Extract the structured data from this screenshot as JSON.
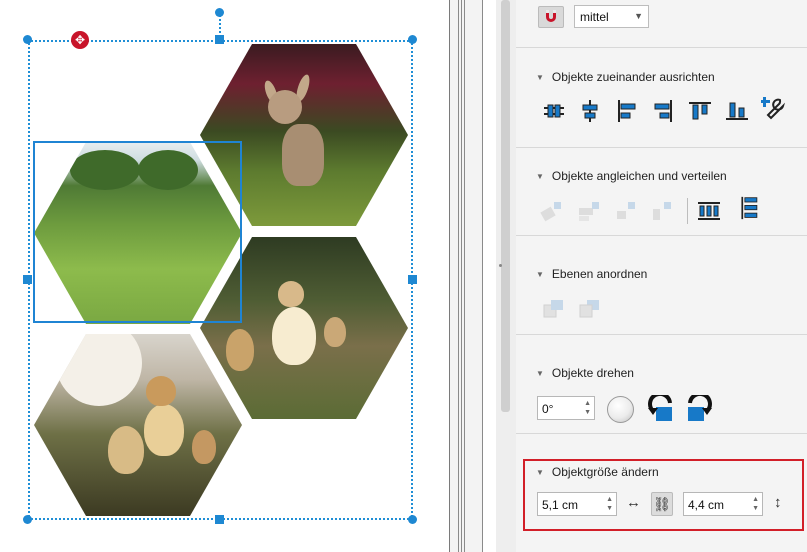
{
  "window": {
    "title": ""
  },
  "panel": {
    "snap": {
      "icon": "magnet-icon",
      "value": "mittel"
    },
    "sections": [
      {
        "title": "Objekte zueinander ausrichten",
        "icons": [
          "align-centers-horizontal-icon",
          "align-centers-vertical-icon",
          "align-left-icon",
          "align-right-icon",
          "align-top-icon",
          "align-bottom-icon",
          "align-settings-icon"
        ]
      },
      {
        "title": "Objekte angleichen und verteilen",
        "icons": [
          "match-width-icon",
          "match-height-icon",
          "match-size-a-icon",
          "match-size-b-icon",
          "distribute-horizontal-icon",
          "distribute-vertical-icon"
        ]
      },
      {
        "title": "Ebenen anordnen",
        "icons": [
          "bring-forward-icon",
          "send-backward-icon"
        ]
      },
      {
        "title": "Objekte drehen",
        "icons": [
          "rotate-left-icon",
          "rotate-right-icon"
        ]
      },
      {
        "title": "Objektgröße ändern",
        "icons": [
          "width-arrows-icon",
          "link-chain-icon",
          "height-arrows-icon"
        ]
      }
    ],
    "rotation": {
      "value": "0°"
    },
    "size": {
      "width": "5,1 cm",
      "height": "4,4 cm"
    }
  },
  "colors": {
    "accent": "#1f84d3",
    "highlight": "#d21f28",
    "active_icon": "#1779c8"
  }
}
